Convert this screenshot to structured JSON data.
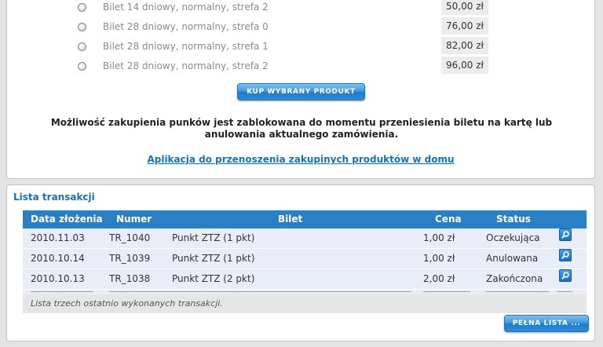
{
  "products": [
    {
      "name": "Bilet 14 dniowy, normalny, strefa 2",
      "price": "50,00 zł"
    },
    {
      "name": "Bilet 28 dniowy, normalny, strefa 0",
      "price": "76,00 zł"
    },
    {
      "name": "Bilet 28 dniowy, normalny, strefa 1",
      "price": "82,00 zł"
    },
    {
      "name": "Bilet 28 dniowy, normalny, strefa 2",
      "price": "96,00 zł"
    }
  ],
  "buy_button": "KUP WYBRANY PRODUKT",
  "notice": "Możliwość zakupienia punków jest zablokowana do momentu przeniesienia biletu na kartę lub anulowania aktualnego zamówienia.",
  "app_link": "Aplikacja do przenoszenia zakupinych produktów w domu",
  "transactions": {
    "title": "Lista transakcji",
    "headers": {
      "date": "Data złożenia",
      "number": "Numer",
      "ticket": "Bilet",
      "price": "Cena",
      "status": "Status"
    },
    "rows": [
      {
        "date": "2010.11.03",
        "number": "TR_1040",
        "ticket": "Punkt ZTZ (1 pkt)",
        "price": "1,00 zł",
        "status": "Oczekująca"
      },
      {
        "date": "2010.10.14",
        "number": "TR_1039",
        "ticket": "Punkt ZTZ (1 pkt)",
        "price": "1,00 zł",
        "status": "Anulowana"
      },
      {
        "date": "2010.10.13",
        "number": "TR_1038",
        "ticket": "Punkt ZTZ (2 pkt)",
        "price": "2,00 zł",
        "status": "Zakończona"
      }
    ],
    "footer": "Lista trzech ostatnio wykonanych transakcji.",
    "full_list_button": "PEŁNA LISTA ..."
  },
  "icons": {
    "radio": "radio-button-icon",
    "details": "magnifier-icon"
  },
  "colors": {
    "accent": "#2980c5",
    "link": "#1f6fae",
    "row_bg": "#e8edf8"
  }
}
